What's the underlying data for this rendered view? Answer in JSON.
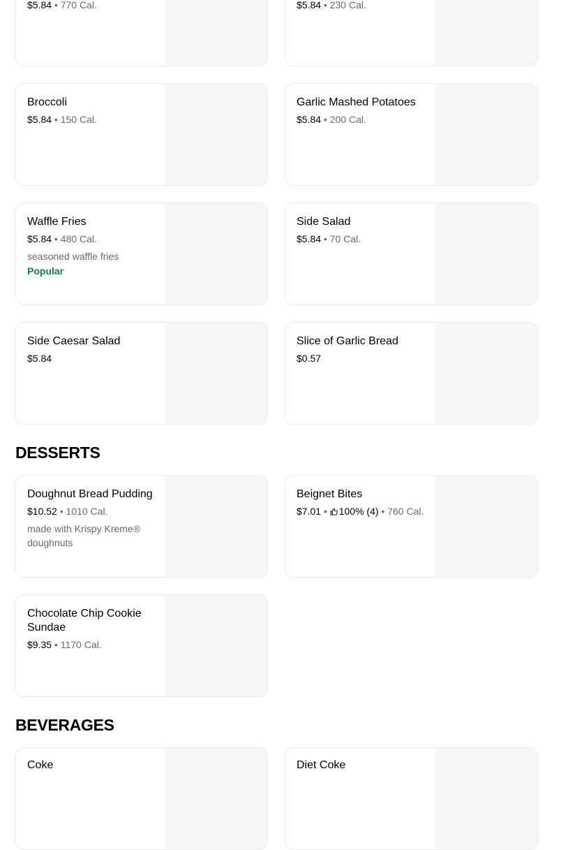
{
  "top_row": [
    {
      "price": "$5.84",
      "calories": "770 Cal."
    },
    {
      "price": "$5.84",
      "calories": "230 Cal."
    }
  ],
  "sides": [
    {
      "name": "Broccoli",
      "price": "$5.84",
      "calories": "150 Cal."
    },
    {
      "name": "Garlic Mashed Potatoes",
      "price": "$5.84",
      "calories": "200 Cal."
    },
    {
      "name": "Waffle Fries",
      "price": "$5.84",
      "calories": "480 Cal.",
      "description": "seasoned waffle fries",
      "badge": "Popular"
    },
    {
      "name": "Side Salad",
      "price": "$5.84",
      "calories": "70 Cal."
    },
    {
      "name": "Side Caesar Salad",
      "price": "$5.84"
    },
    {
      "name": "Slice of Garlic Bread",
      "price": "$0.57"
    }
  ],
  "desserts": {
    "title": "DESSERTS",
    "items": [
      {
        "name": "Doughnut Bread Pudding",
        "price": "$10.52",
        "calories": "1010 Cal.",
        "description": "made with Krispy Kreme® doughnuts"
      },
      {
        "name": "Beignet Bites",
        "price": "$7.01",
        "rating": "100% (4)",
        "calories": "760 Cal."
      },
      {
        "name": "Chocolate Chip Cookie Sundae",
        "price": "$9.35",
        "calories": "1170 Cal."
      }
    ]
  },
  "beverages": {
    "title": "BEVERAGES",
    "items": [
      {
        "name": "Coke"
      },
      {
        "name": "Diet Coke"
      }
    ]
  },
  "colors": {
    "popular": "#0e8345",
    "muted": "#6b6b6b",
    "card_border": "#ececec",
    "image_bg": "#f6f6f6"
  },
  "icons": {
    "rating": "thumbs-up-icon"
  }
}
